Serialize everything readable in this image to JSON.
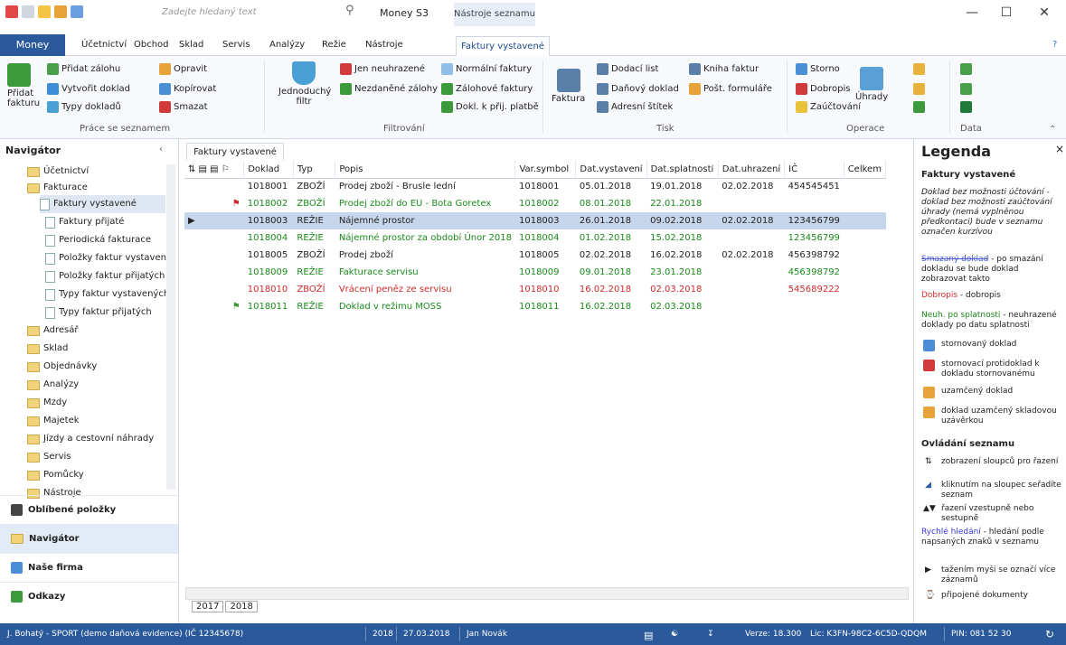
{
  "titlebar": {
    "search_placeholder": "Zadejte hledaný text",
    "title": "Money S3",
    "context_tab": "Nástroje seznamu"
  },
  "menu": {
    "money": "Money",
    "items": [
      "Účetnictví",
      "Obchod",
      "Sklad",
      "Servis",
      "Analýzy",
      "Režie",
      "Nástroje"
    ],
    "active": "Faktury vystavené"
  },
  "ribbon": {
    "add_invoice": "Přidat fakturu",
    "add_advance": "Přidat zálohu",
    "create_doc": "Vytvořit doklad",
    "doc_types": "Typy dokladů",
    "edit": "Opravit",
    "copy": "Kopírovat",
    "delete": "Smazat",
    "group1": "Práce se seznamem",
    "simple_filter": "Jednoduchý filtr",
    "only_unpaid": "Jen neuhrazené",
    "untaxed_adv": "Nezdaněné zálohy",
    "normal_inv": "Normální faktury",
    "advance_inv": "Zálohové faktury",
    "doc_received_pay": "Dokl. k přij. platbě",
    "group2": "Filtrování",
    "invoice": "Faktura",
    "delivery_note": "Dodací list",
    "tax_doc": "Daňový doklad",
    "address_label": "Adresní štítek",
    "invoice_book": "Kniha faktur",
    "post_forms": "Pošt. formuláře",
    "group3": "Tisk",
    "storno": "Storno",
    "credit_note": "Dobropis",
    "post": "Zaúčtování",
    "payments": "Úhrady",
    "group4": "Operace",
    "group5": "Data"
  },
  "nav": {
    "header": "Navigátor",
    "tree": [
      "Účetnictví",
      "Fakturace",
      "Faktury vystavené",
      "Faktury přijaté",
      "Periodická fakturace",
      "Položky faktur vystavený",
      "Položky faktur přijatých",
      "Typy faktur vystavených",
      "Typy faktur přijatých",
      "Adresář",
      "Sklad",
      "Objednávky",
      "Analýzy",
      "Mzdy",
      "Majetek",
      "Jízdy a cestovní náhrady",
      "Servis",
      "Pomůcky",
      "Nástroje"
    ],
    "favorites": "Oblíbené položky",
    "navigator": "Navigátor",
    "company": "Naše firma",
    "links": "Odkazy"
  },
  "grid": {
    "tab": "Faktury vystavené",
    "headers": [
      "Doklad",
      "Typ",
      "Popis",
      "Var.symbol",
      "Dat.vystavení",
      "Dat.splatnosti",
      "Dat.uhrazení",
      "IČ",
      "Celkem"
    ],
    "rows": [
      [
        "1018001",
        "ZBOŽÍ",
        "Prodej zboží - Brusle lední",
        "1018001",
        "05.01.2018",
        "19.01.2018",
        "02.02.2018",
        "454545451",
        ""
      ],
      [
        "1018002",
        "ZBOŽÍ",
        "Prodej zboží do EU - Bota Goretex",
        "1018002",
        "08.01.2018",
        "22.01.2018",
        "",
        "",
        ""
      ],
      [
        "1018003",
        "REŽIE",
        "Nájemné prostor",
        "1018003",
        "26.01.2018",
        "09.02.2018",
        "02.02.2018",
        "123456799",
        ""
      ],
      [
        "1018004",
        "REŽIE",
        "Nájemné prostor za období Únor 2018",
        "1018004",
        "01.02.2018",
        "15.02.2018",
        "",
        "123456799",
        ""
      ],
      [
        "1018005",
        "ZBOŽÍ",
        "Prodej zboží",
        "1018005",
        "02.02.2018",
        "16.02.2018",
        "02.02.2018",
        "456398792",
        ""
      ],
      [
        "1018009",
        "REŽIE",
        "Fakturace servisu",
        "1018009",
        "09.01.2018",
        "23.01.2018",
        "",
        "456398792",
        ""
      ],
      [
        "1018010",
        "ZBOŽÍ",
        "Vrácení peněz ze servisu",
        "1018010",
        "16.02.2018",
        "02.03.2018",
        "",
        "545689222",
        ""
      ],
      [
        "1018011",
        "REŽIE",
        "Doklad v režimu MOSS",
        "1018011",
        "16.02.2018",
        "02.03.2018",
        "",
        "",
        ""
      ]
    ],
    "year_tabs": [
      "2017",
      "2018"
    ]
  },
  "legend": {
    "title": "Legenda",
    "sec1": "Faktury vystavené",
    "l1": "Doklad bez možnosti účtování - doklad bez možnosti zaúčtování úhrady (nemá vyplněnou předkontaci) bude v seznamu označen kurzívou",
    "l2a": "Smazaný doklad",
    "l2b": " - po smazání dokladu se bude doklad zobrazovat takto",
    "l3a": "Dobropis",
    "l3b": " - dobropis",
    "l4a": "Neuh. po splatnosti",
    "l4b": " - neuhrazené doklady po datu splatnosti",
    "l5": "stornovaný doklad",
    "l6": "stornovací protidoklad k dokladu stornovanému",
    "l7": "uzamčený doklad",
    "l8": "doklad uzamčený skladovou uzávěrkou",
    "sec2": "Ovládání seznamu",
    "c1": "zobrazení sloupců pro řazení",
    "c2": "kliknutím na sloupec seřadíte seznam",
    "c3": "řazení vzestupně nebo sestupně",
    "c4a": "Rychlé hledání",
    "c4b": " - hledání podle napsaných znaků v seznamu",
    "c5": "tažením myši se označí více záznamů",
    "c6": "připojené dokumenty"
  },
  "status": {
    "company": "J. Bohatý - SPORT (demo daňová evidence) (IČ 12345678)",
    "year": "2018",
    "date": "27.03.2018",
    "user": "Jan Novák",
    "version": "Verze: 18.300",
    "lic": "Lic: K3FN-98C2-6C5D-QDQM",
    "pin": "PIN: 081 52 30"
  }
}
